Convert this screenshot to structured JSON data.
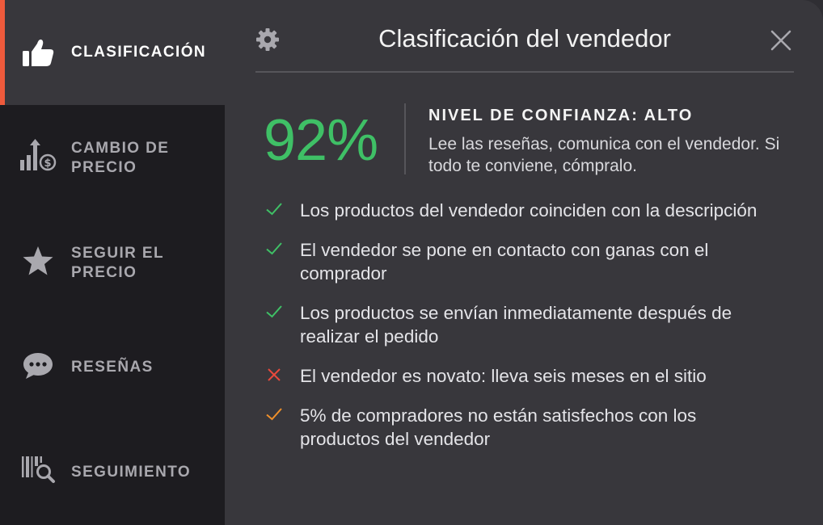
{
  "sidebar": {
    "items": [
      {
        "key": "rating",
        "label": "CLASIFICACIÓN",
        "icon": "thumbs-up-icon",
        "active": true
      },
      {
        "key": "price-change",
        "label": "CAMBIO DE PRECIO",
        "icon": "price-chart-icon",
        "active": false
      },
      {
        "key": "track-price",
        "label": "SEGUIR EL PRECIO",
        "icon": "star-icon",
        "active": false
      },
      {
        "key": "reviews",
        "label": "RESEÑAS",
        "icon": "chat-bubble-icon",
        "active": false
      },
      {
        "key": "tracking",
        "label": "SEGUIMIENTO",
        "icon": "barcode-search-icon",
        "active": false
      }
    ],
    "accent_color": "#ee5a3c"
  },
  "header": {
    "title": "Clasificación del vendedor",
    "settings_icon": "gear-icon",
    "close_icon": "close-icon"
  },
  "summary": {
    "score": "92%",
    "score_color": "#3fc066",
    "trust_title": "NIVEL DE CONFIANZA: ALTO",
    "trust_text": "Lee las reseñas, comunica con el vendedor. Si todo te conviene, cómpralo."
  },
  "checks": [
    {
      "status": "ok",
      "color": "#3fc066",
      "text": "Los productos del vendedor coinciden con la descripción"
    },
    {
      "status": "ok",
      "color": "#3fc066",
      "text": "El vendedor se pone en contacto con ganas con el comprador"
    },
    {
      "status": "ok",
      "color": "#3fc066",
      "text": "Los productos se envían inmediatamente después de realizar el pedido"
    },
    {
      "status": "bad",
      "color": "#e8493c",
      "text": "El vendedor es novato: lleva seis meses en el sitio"
    },
    {
      "status": "warn",
      "color": "#f0902a",
      "text": "5% de compradores no están satisfechos con los productos del vendedor"
    }
  ]
}
